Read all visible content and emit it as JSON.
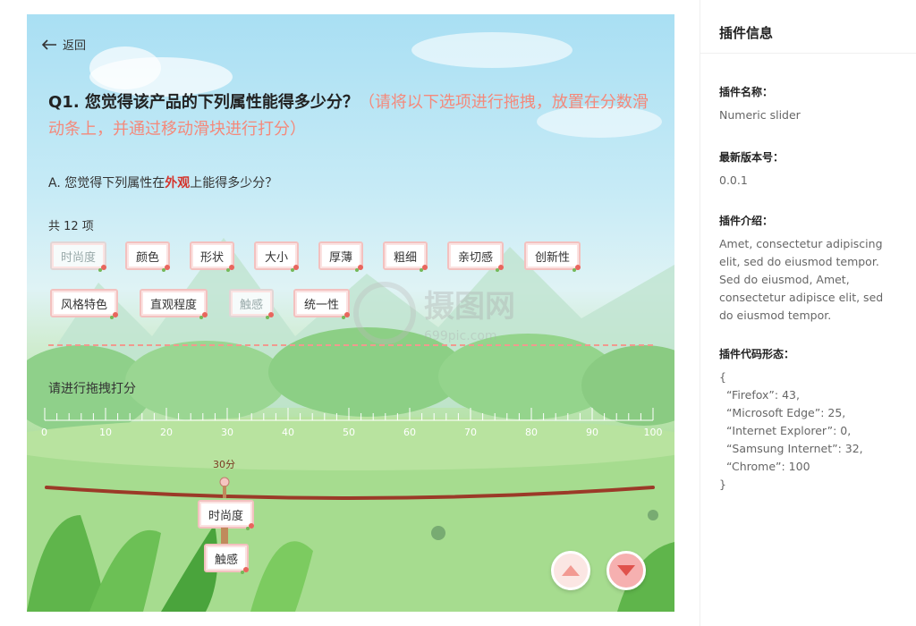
{
  "survey": {
    "back_label": "返回",
    "question_main": "Q1. 您觉得该产品的下列属性能得多少分？",
    "question_hint": "（请将以下选项进行拖拽，放置在分数滑动条上，并通过移动滑块进行打分）",
    "sub_question_prefix": "A. 您觉得下列属性在",
    "sub_question_highlight": "外观",
    "sub_question_suffix": "上能得多少分？",
    "count_label": "共 12 项",
    "tags": [
      {
        "label": "时尚度",
        "disabled": true
      },
      {
        "label": "颜色",
        "disabled": false
      },
      {
        "label": "形状",
        "disabled": false
      },
      {
        "label": "大小",
        "disabled": false
      },
      {
        "label": "厚薄",
        "disabled": false
      },
      {
        "label": "粗细",
        "disabled": false
      },
      {
        "label": "亲切感",
        "disabled": false
      },
      {
        "label": "创新性",
        "disabled": false
      },
      {
        "label": "风格特色",
        "disabled": false
      },
      {
        "label": "直观程度",
        "disabled": false
      },
      {
        "label": "触感",
        "disabled": true
      },
      {
        "label": "统一性",
        "disabled": false
      }
    ],
    "drag_title": "请进行拖拽打分",
    "scale": {
      "min": 0,
      "max": 100,
      "labels": [
        "0",
        "10",
        "20",
        "30",
        "40",
        "50",
        "60",
        "70",
        "80",
        "90",
        "100"
      ]
    },
    "score_label": "30分",
    "placed_items": [
      {
        "label": "时尚度",
        "score": 30
      },
      {
        "label": "触感",
        "score": 30
      }
    ],
    "watermark_text": "摄图网",
    "watermark_sub": "699pic.com",
    "nav_up_icon": "chevron-up-icon",
    "nav_down_icon": "chevron-down-icon"
  },
  "panel": {
    "title": "插件信息",
    "name_label": "插件名称：",
    "name_value": "Numeric slider",
    "version_label": "最新版本号：",
    "version_value": "0.0.1",
    "intro_label": "插件介绍：",
    "intro_value": "Amet, consectetur adipiscing elit, sed do eiusmod tempor. Sed do eiusmod, Amet, consectetur adipisce elit, sed do eiusmod tempor.",
    "code_label": "插件代码形态：",
    "code_lines": [
      "{",
      "  “Firefox”: 43,",
      "  “Microsoft Edge”: 25,",
      "  “Internet Explorer”: 0,",
      "  “Samsung Internet”: 32,",
      "  “Chrome”: 100",
      "}"
    ]
  },
  "colors": {
    "accent_red": "#d4332b",
    "hint_salmon": "#f4897b",
    "track_brown": "#9b3a28"
  }
}
